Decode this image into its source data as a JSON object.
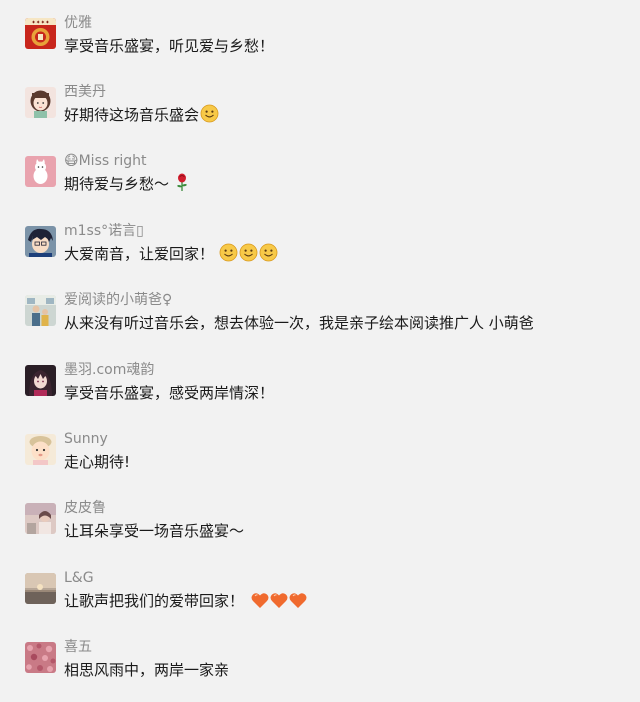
{
  "comments": [
    {
      "nickname": "优雅",
      "text": "享受音乐盛宴，听见爱与乡愁！",
      "avatar": "calligraphy-logo-avatar",
      "trailing_emojis": []
    },
    {
      "nickname": "西美丹",
      "text": "好期待这场音乐盛会",
      "avatar": "cartoon-girl-avatar",
      "trailing_emojis": [
        "smile"
      ]
    },
    {
      "nickname": "😷Miss right",
      "text": "期待爱与乡愁～",
      "avatar": "white-cat-avatar",
      "trailing_emojis": [
        "rose"
      ]
    },
    {
      "nickname": "m1ss°诺言▯",
      "text": "大爱南音，让爱回家！",
      "avatar": "anime-boy-avatar",
      "trailing_emojis": [
        "smile",
        "smile",
        "smile"
      ]
    },
    {
      "nickname": "爱阅读的小萌爸♀",
      "text": "从来没有听过音乐会，想去体验一次，我是亲子绘本阅读推广人 小萌爸",
      "avatar": "family-photo-avatar",
      "trailing_emojis": []
    },
    {
      "nickname": "墨羽.com魂韵",
      "text": "享受音乐盛宴，感受两岸情深！",
      "avatar": "dark-anime-avatar",
      "trailing_emojis": []
    },
    {
      "nickname": "Sunny",
      "text": "走心期待!",
      "avatar": "baby-avatar",
      "trailing_emojis": []
    },
    {
      "nickname": "皮皮鲁",
      "text": "让耳朵享受一场音乐盛宴～",
      "avatar": "soft-photo-avatar",
      "trailing_emojis": []
    },
    {
      "nickname": "L&G",
      "text": "让歌声把我们的爱带回家！",
      "avatar": "sunset-avatar",
      "trailing_emojis": [
        "heart",
        "heart",
        "heart"
      ]
    },
    {
      "nickname": "喜五",
      "text": "相思风雨中，两岸一家亲",
      "avatar": "flower-field-avatar",
      "trailing_emojis": []
    }
  ],
  "colors": {
    "background": "#f2f2f2",
    "nickname": "#8a8a8a",
    "text": "#1a1a1a",
    "heart": "#f06a2e",
    "smile": "#f7c948"
  }
}
